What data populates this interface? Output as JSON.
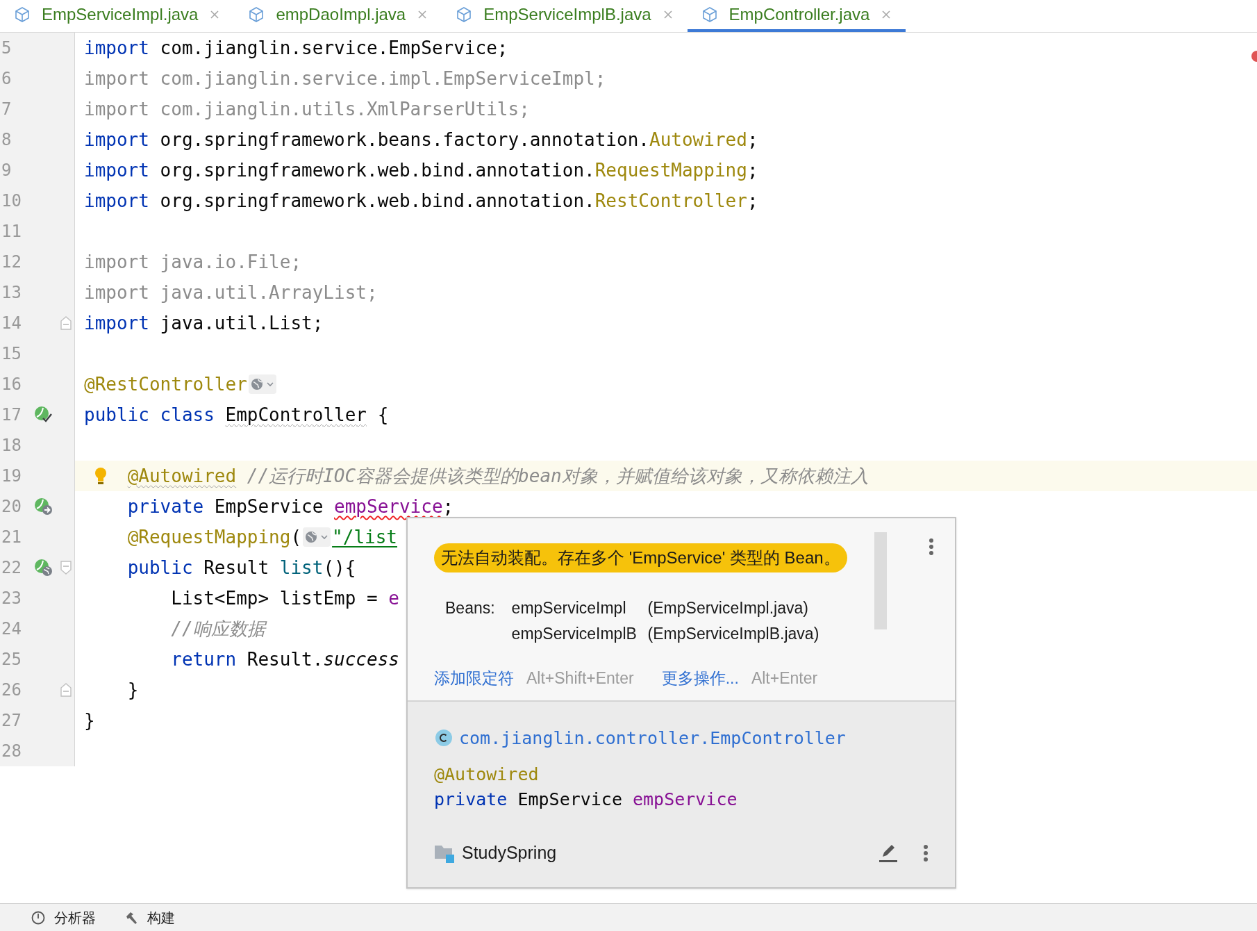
{
  "tabs": [
    {
      "label": "EmpServiceImpl.java",
      "selected": false
    },
    {
      "label": "empDaoImpl.java",
      "selected": false
    },
    {
      "label": "EmpServiceImplB.java",
      "selected": false
    },
    {
      "label": "EmpController.java",
      "selected": true
    }
  ],
  "lines": [
    {
      "number": "5",
      "kind": "plain",
      "tokens": [
        {
          "text": "import",
          "kind": "keyword"
        },
        {
          "text": " com.jianglin.service.EmpService;",
          "kind": "plain"
        }
      ]
    },
    {
      "number": "6",
      "kind": "plain",
      "tokens": [
        {
          "text": "import com.jianglin.service.impl.EmpServiceImpl;",
          "kind": "unused"
        }
      ]
    },
    {
      "number": "7",
      "kind": "plain",
      "tokens": [
        {
          "text": "import com.jianglin.utils.XmlParserUtils;",
          "kind": "unused"
        }
      ]
    },
    {
      "number": "8",
      "kind": "plain",
      "tokens": [
        {
          "text": "import",
          "kind": "keyword"
        },
        {
          "text": " org.springframework.beans.factory.annotation.",
          "kind": "plain"
        },
        {
          "text": "Autowired",
          "kind": "annotation"
        },
        {
          "text": ";",
          "kind": "plain"
        }
      ]
    },
    {
      "number": "9",
      "kind": "plain",
      "tokens": [
        {
          "text": "import",
          "kind": "keyword"
        },
        {
          "text": " org.springframework.web.bind.annotation.",
          "kind": "plain"
        },
        {
          "text": "RequestMapping",
          "kind": "annotation"
        },
        {
          "text": ";",
          "kind": "plain"
        }
      ]
    },
    {
      "number": "10",
      "kind": "plain",
      "tokens": [
        {
          "text": "import",
          "kind": "keyword"
        },
        {
          "text": " org.springframework.web.bind.annotation.",
          "kind": "plain"
        },
        {
          "text": "RestController",
          "kind": "annotation"
        },
        {
          "text": ";",
          "kind": "plain"
        }
      ]
    },
    {
      "number": "11",
      "kind": "plain"
    },
    {
      "number": "12",
      "kind": "plain",
      "tokens": [
        {
          "text": "import java.io.File;",
          "kind": "unused"
        }
      ]
    },
    {
      "number": "13",
      "kind": "plain",
      "tokens": [
        {
          "text": "import java.util.ArrayList;",
          "kind": "unused"
        }
      ]
    },
    {
      "number": "14",
      "kind": "plain",
      "fold_end": true,
      "tokens": [
        {
          "text": "import",
          "kind": "keyword"
        },
        {
          "text": " java.util.List;",
          "kind": "plain"
        }
      ]
    },
    {
      "number": "15",
      "kind": "plain"
    },
    {
      "number": "16",
      "kind": "plain",
      "tokens": [
        {
          "text": "@RestController",
          "kind": "annotation"
        },
        {
          "kind": "web_hint"
        }
      ]
    },
    {
      "number": "17",
      "kind": "bean_check",
      "tokens": [
        {
          "text": "public class ",
          "kind": "keyword"
        },
        {
          "text": "EmpController",
          "kind": "plain",
          "weak_warning": true
        },
        {
          "text": " {",
          "kind": "plain"
        }
      ]
    },
    {
      "number": "18",
      "kind": "plain"
    },
    {
      "number": "19",
      "kind": "plain",
      "highlighted": true,
      "bulb": true,
      "tokens": [
        {
          "text": "    @Autowired",
          "kind": "annotation",
          "weak_warning": true
        },
        {
          "text": " //运行时IOC容器会提供该类型的bean对象，并赋值给该对象，又称依赖注入",
          "kind": "comment"
        }
      ]
    },
    {
      "number": "20",
      "kind": "bean_arrow",
      "tokens": [
        {
          "text": "    private",
          "kind": "keyword"
        },
        {
          "text": " EmpService ",
          "kind": "plain"
        },
        {
          "text": "empService",
          "kind": "field",
          "error": true
        },
        {
          "text": ";",
          "kind": "plain"
        }
      ]
    },
    {
      "number": "21",
      "kind": "plain",
      "tokens": [
        {
          "text": "    @RequestMapping",
          "kind": "annotation"
        },
        {
          "text": "(",
          "kind": "plain"
        },
        {
          "kind": "web_hint"
        },
        {
          "text": "\"/list",
          "kind": "string",
          "link": true
        }
      ]
    },
    {
      "number": "22",
      "kind": "bean_web",
      "fold_start": true,
      "tokens": [
        {
          "text": "    public",
          "kind": "keyword"
        },
        {
          "text": " Result ",
          "kind": "plain"
        },
        {
          "text": "list",
          "kind": "method"
        },
        {
          "text": "(){",
          "kind": "plain"
        }
      ]
    },
    {
      "number": "23",
      "kind": "plain",
      "tokens": [
        {
          "text": "        List<Emp> listEmp = ",
          "kind": "plain"
        },
        {
          "text": "e",
          "kind": "field"
        }
      ]
    },
    {
      "number": "24",
      "kind": "plain",
      "tokens": [
        {
          "text": "        //响应数据",
          "kind": "comment"
        }
      ]
    },
    {
      "number": "25",
      "kind": "plain",
      "tokens": [
        {
          "text": "        return",
          "kind": "keyword"
        },
        {
          "text": " Result.",
          "kind": "plain"
        },
        {
          "text": "success",
          "kind": "italic"
        }
      ]
    },
    {
      "number": "26",
      "kind": "plain",
      "fold_end": true,
      "tokens": [
        {
          "text": "    }",
          "kind": "plain"
        }
      ]
    },
    {
      "number": "27",
      "kind": "plain",
      "tokens": [
        {
          "text": "}",
          "kind": "plain"
        }
      ]
    },
    {
      "number": "28",
      "kind": "plain"
    }
  ],
  "popup": {
    "problem": "无法自动装配。存在多个 'EmpService' 类型的 Bean。",
    "beans_label": "Beans:",
    "beans": [
      {
        "name": "empServiceImpl",
        "file": "(EmpServiceImpl.java)"
      },
      {
        "name": "empServiceImplB",
        "file": "(EmpServiceImplB.java)"
      }
    ],
    "actions": [
      {
        "label": "添加限定符",
        "shortcut": "Alt+Shift+Enter"
      },
      {
        "label": "更多操作...",
        "shortcut": "Alt+Enter"
      }
    ],
    "class_ref": "com.jianglin.controller.EmpController",
    "declaration": [
      [
        {
          "text": "@Autowired",
          "kind": "annotation"
        }
      ],
      [
        {
          "text": "private",
          "kind": "keyword"
        },
        {
          "text": " EmpService ",
          "kind": "plain"
        },
        {
          "text": "empService",
          "kind": "field"
        }
      ]
    ],
    "project": "StudySpring"
  },
  "status_bar": [
    {
      "label": "分析器",
      "kind": "profiler"
    },
    {
      "label": "构建",
      "kind": "build"
    }
  ]
}
